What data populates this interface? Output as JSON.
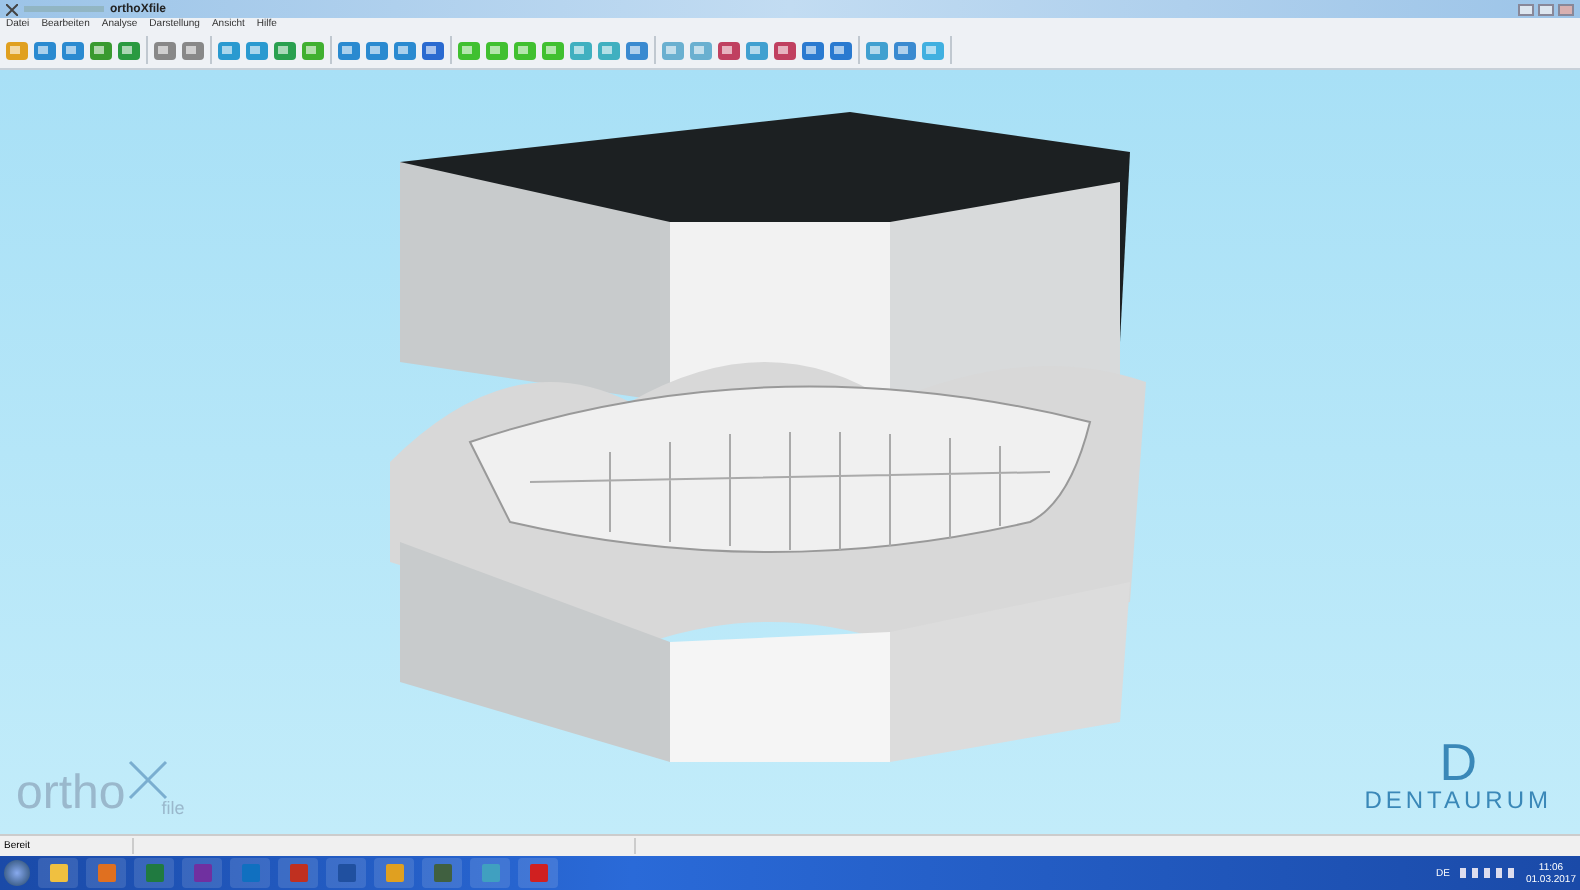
{
  "window": {
    "title": "orthoXfile"
  },
  "menu": [
    "Datei",
    "Bearbeiten",
    "Analyse",
    "Darstellung",
    "Ansicht",
    "Hilfe"
  ],
  "viewport": {
    "brand_left": {
      "main": "ortho",
      "sub": "file"
    },
    "brand_right": {
      "mark": "D",
      "name": "DENTAURUM"
    }
  },
  "status_bar": {
    "text": "Bereit"
  },
  "taskbar": {
    "language": "DE",
    "time": "11:06",
    "date": "01.03.2017"
  }
}
